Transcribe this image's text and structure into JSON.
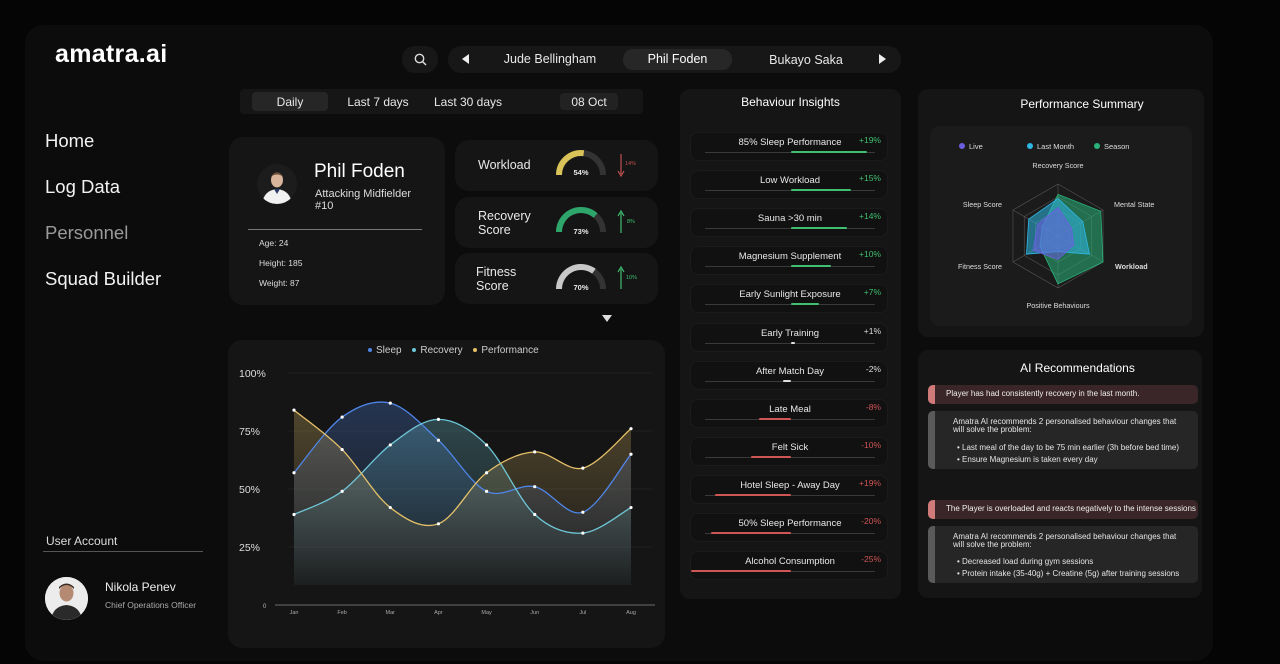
{
  "brand": "amatra.ai",
  "nav": [
    "Home",
    "Log Data",
    "Personnel",
    "Squad Builder"
  ],
  "account": {
    "label": "User Account",
    "name": "Nikola Penev",
    "role": "Chief Operations Officer"
  },
  "players": [
    "Jude Bellingham",
    "Phil Foden",
    "Bukayo Saka"
  ],
  "periods": [
    "Daily",
    "Last 7 days",
    "Last 30 days",
    "08 Oct"
  ],
  "player": {
    "name": "Phil Foden",
    "position": "Attacking Midfielder",
    "number": "#10",
    "age": "Age: 24",
    "height": "Height: 185",
    "weight": "Weight: 87"
  },
  "metrics": [
    {
      "label_1": "Workload",
      "label_2": "",
      "value": "54%",
      "fraction": 0.54,
      "trend": "14%",
      "trend_dir": "down",
      "color": "#d9c257",
      "trend_color": "#c25050"
    },
    {
      "label_1": "Recovery",
      "label_2": "Score",
      "value": "73%",
      "fraction": 0.73,
      "trend": "8%",
      "trend_dir": "up",
      "color": "#2ea66b",
      "trend_color": "#3fbf6f"
    },
    {
      "label_1": "Fitness",
      "label_2": "Score",
      "value": "70%",
      "fraction": 0.7,
      "trend": "10%",
      "trend_dir": "up",
      "color": "#c8c8c8",
      "trend_color": "#3fbf6f"
    }
  ],
  "chart_data": {
    "type": "area",
    "legend": [
      "Sleep",
      "Recovery",
      "Performance"
    ],
    "series_colors": [
      "#4f86e8",
      "#6fc7d8",
      "#e6c169"
    ],
    "x": [
      "Jan",
      "Feb",
      "Mar",
      "Apr",
      "May",
      "Jun",
      "Jul",
      "Aug"
    ],
    "y_ticks": [
      "100%",
      "75%",
      "50%",
      "25%",
      "0"
    ],
    "ylim": [
      0,
      100
    ],
    "series": [
      {
        "name": "Sleep",
        "values": [
          57,
          81,
          87,
          71,
          49,
          51,
          40,
          65
        ]
      },
      {
        "name": "Recovery",
        "values": [
          39,
          49,
          69,
          80,
          69,
          39,
          31,
          42
        ]
      },
      {
        "name": "Performance",
        "values": [
          84,
          67,
          42,
          35,
          57,
          66,
          59,
          76
        ]
      }
    ]
  },
  "behaviour": {
    "title": "Behaviour Insights",
    "items": [
      {
        "label": "85% Sleep Performance",
        "delta": "+19%",
        "value": 19
      },
      {
        "label": "Low Workload",
        "delta": "+15%",
        "value": 15
      },
      {
        "label": "Sauna >30 min",
        "delta": "+14%",
        "value": 14
      },
      {
        "label": "Magnesium Supplement",
        "delta": "+10%",
        "value": 10
      },
      {
        "label": "Early Sunlight Exposure",
        "delta": "+7%",
        "value": 7
      },
      {
        "label": "Early Training",
        "delta": "+1%",
        "value": 1
      },
      {
        "label": "After Match Day",
        "delta": "-2%",
        "value": -2
      },
      {
        "label": "Late Meal",
        "delta": "-8%",
        "value": -8
      },
      {
        "label": "Felt Sick",
        "delta": "-10%",
        "value": -10
      },
      {
        "label": "Hotel Sleep - Away Day",
        "delta": "+19%",
        "value": -19
      },
      {
        "label": "50% Sleep Performance",
        "delta": "-20%",
        "value": -20
      },
      {
        "label": "Alcohol Consumption",
        "delta": "-25%",
        "value": -25
      }
    ]
  },
  "summary": {
    "title": "Performance Summary",
    "legend": [
      "Live",
      "Last Month",
      "Season"
    ],
    "legend_colors": [
      "#6b5fe0",
      "#2fb8e6",
      "#29b27a"
    ],
    "axes": [
      "Recovery Score",
      "Mental State",
      "Workload",
      "Positive Behaviours",
      "Fitness Score",
      "Sleep Score"
    ],
    "series": [
      {
        "name": "Live",
        "values": [
          0.55,
          0.3,
          0.35,
          0.45,
          0.55,
          0.45
        ]
      },
      {
        "name": "Last Month",
        "values": [
          0.72,
          0.55,
          0.7,
          0.3,
          0.7,
          0.65
        ]
      },
      {
        "name": "Season",
        "values": [
          0.8,
          0.95,
          1.0,
          0.92,
          0.4,
          0.35
        ]
      }
    ]
  },
  "ai": {
    "title": "AI Recommendations",
    "alert_1": "Player has had consistently recovery in the last month.",
    "rec_1_text": "Amatra AI recommends 2 personalised behaviour changes that will solve the problem:",
    "rec_1_bullets": [
      "Last meal of the day to be 75 min earlier (3h before bed time)",
      "Ensure Magnesium is taken every day"
    ],
    "alert_2": "The Player is overloaded and reacts negatively to the intense sessions",
    "rec_2_text": "Amatra AI recommends 2 personalised behaviour changes that will solve the problem:",
    "rec_2_bullets": [
      "Decreased load during gym sessions",
      "Protein intake (35-40g) + Creatine (5g) after training sessions"
    ]
  }
}
